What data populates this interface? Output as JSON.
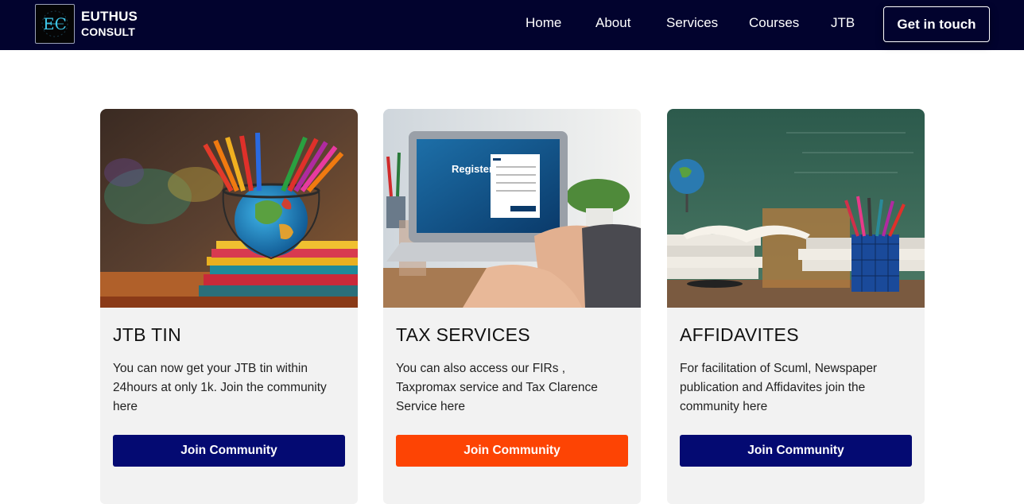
{
  "brand": {
    "line1": "EUTHUS",
    "line2": "CONSULT"
  },
  "nav": {
    "links": [
      "Home",
      "About",
      "Services",
      "Courses",
      "JTB"
    ],
    "cta": "Get in touch"
  },
  "cards": [
    {
      "title": "JTB TIN",
      "text": "You can now get your JTB tin within 24hours at only 1k. Join the community here",
      "button": "Join Community",
      "button_color": "#040a72"
    },
    {
      "title": "TAX SERVICES",
      "text": "You can also access our FIRs , Taxpromax service and Tax Clarence Service here",
      "button": "Join Community",
      "button_color": "#fd4404"
    },
    {
      "title": "AFFIDAVITES",
      "text": "For facilitation of Scuml, Newspaper publication and Affidavites join the community here",
      "button": "Join Community",
      "button_color": "#040a72"
    }
  ],
  "colors": {
    "navbar_bg": "#02032e",
    "card_bg": "#f2f2f2",
    "primary_button": "#040a72",
    "accent_button": "#fd4404"
  },
  "icons": {
    "logo": "euthus-consult-logo-icon",
    "card1_image": "pencils-globe-books-image",
    "card2_image": "laptop-register-image",
    "card3_image": "books-pencil-holder-image"
  }
}
